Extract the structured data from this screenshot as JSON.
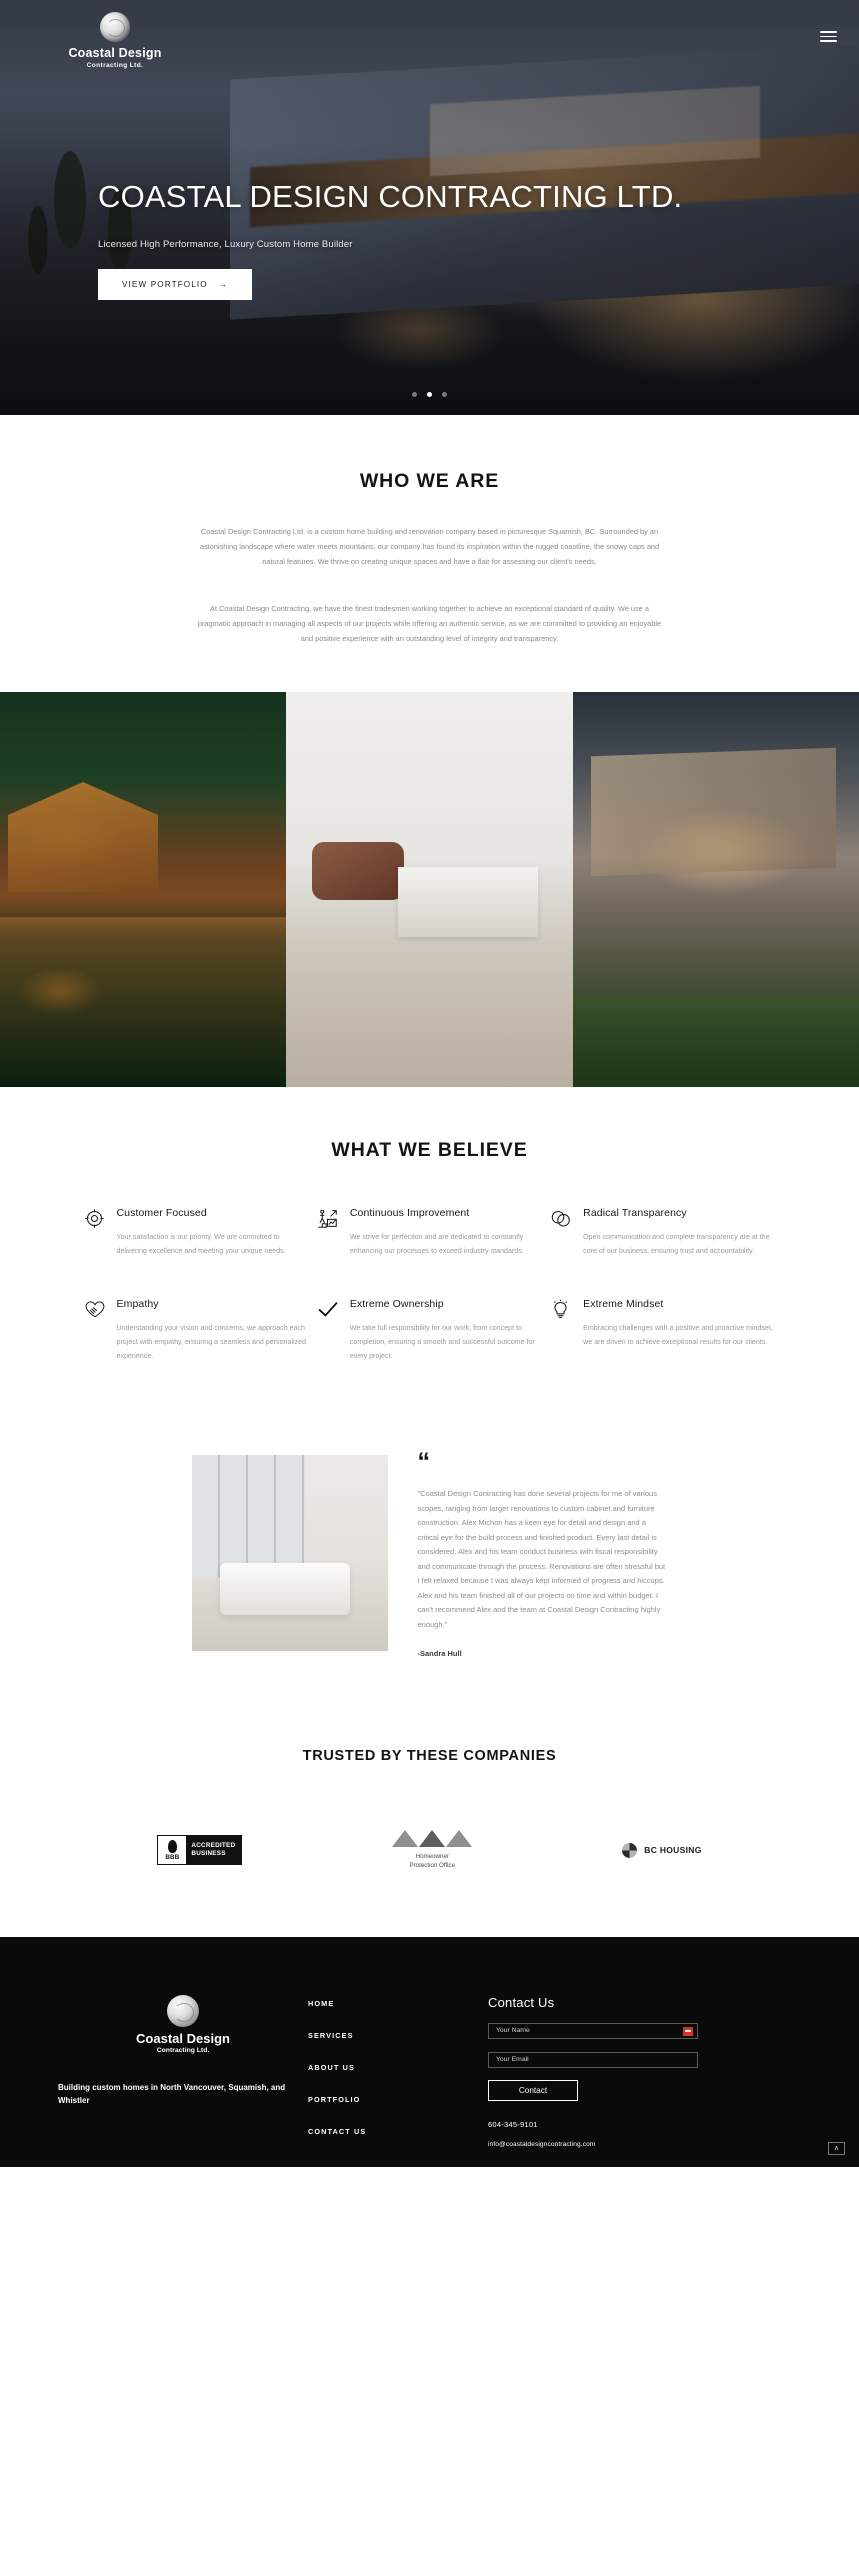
{
  "hero": {
    "logo_name": "Coastal Design",
    "logo_sub": "Contracting Ltd.",
    "title": "COASTAL DESIGN CONTRACTING LTD.",
    "tagline": "Licensed High Performance, Luxury Custom Home Builder",
    "button": "VIEW PORTFOLIO",
    "button_arrow": "→",
    "slides": 3,
    "active_slide": 1
  },
  "who": {
    "title": "WHO WE ARE",
    "paragraph1": "Coastal Design Contracting Ltd. is a custom home building and renovation company based in picturesque Squamish, BC. Surrounded by an astonishing landscape where water meets mountains, our company has found its inspiration within the rugged coastline, the snowy caps and natural features. We thrive on creating unique spaces and have a flair for assessing our client's needs.",
    "paragraph2": "At Coastal Design Contracting, we have the finest tradesmen working together to achieve an exceptional standard of quality. We use a pragmatic approach in managing all aspects of our projects while offering an authentic service, as we are committed to providing an enjoyable and positive experience with an outstanding level of integrity and transparency."
  },
  "believe": {
    "title": "WHAT WE BELIEVE",
    "values": [
      {
        "icon": "target-icon",
        "heading": "Customer Focused",
        "text": "Your satisfaction is our priority. We are committed to delivering excellence and meeting your unique needs."
      },
      {
        "icon": "growth-chart-person-icon",
        "heading": "Continuous Improvement",
        "text": "We strive for perfection and are dedicated to constantly enhancing our processes to exceed industry standards."
      },
      {
        "icon": "overlapping-circles-icon",
        "heading": "Radical Transparency",
        "text": "Open communication and complete transparency are at the core of our business, ensuring trust and accountability."
      },
      {
        "icon": "handshake-heart-icon",
        "heading": "Empathy",
        "text": "Understanding your vision and concerns, we approach each project with empathy, ensuring a seamless and personalized experience."
      },
      {
        "icon": "checkmark-icon",
        "heading": "Extreme Ownership",
        "text": "We take full responsibility for our work, from concept to completion, ensuring a smooth and successful outcome for every project."
      },
      {
        "icon": "lightbulb-icon",
        "heading": "Extreme Mindset",
        "text": "Embracing challenges with a positive and proactive mindset, we are driven to achieve exceptional results for our clients."
      }
    ]
  },
  "testimonial": {
    "quote_glyph": "“",
    "body": "\"Coastal Design Contracting has done several projects for me of various scopes, ranging from larger renovations to custom cabinet and furniture construction. Alex Michon has a keen eye for detail and design and a critical eye for the build process and finished product. Every last detail is considered. Alex and his team conduct business with fiscal responsibility and communicate through the process. Renovations are often stressful but I felt relaxed because I was always kept informed of progress and hiccups. Alex and his team finished all of our projects on time and within budget. I can't recommend Alex and the team at Coastal Design Contracting highly enough.\"",
    "author": "-Sandra Hull"
  },
  "trusted": {
    "title": "TRUSTED BY THESE COMPANIES",
    "logos": [
      {
        "name": "bbb-accredited-business-logo",
        "mark": "BBB",
        "line1": "ACCREDITED",
        "line2": "BUSINESS"
      },
      {
        "name": "homeowner-protection-office-logo",
        "line1": "Homeowner",
        "line2": "Protection Office"
      },
      {
        "name": "bc-housing-logo",
        "label": "BC HOUSING"
      }
    ]
  },
  "footer": {
    "logo_name": "Coastal Design",
    "logo_sub": "Contracting Ltd.",
    "tagline": "Building custom homes in North Vancouver, Squamish, and Whistler",
    "nav": [
      "HOME",
      "SERVICES",
      "ABOUT US",
      "PORTFOLIO",
      "CONTACT US"
    ],
    "contact_title": "Contact Us",
    "name_placeholder": "Your Name",
    "email_placeholder": "Your Email",
    "submit_label": "Contact",
    "phone": "604-345-9101",
    "email": "info@coastaldesigncontracting.com",
    "to_top": "∧"
  }
}
